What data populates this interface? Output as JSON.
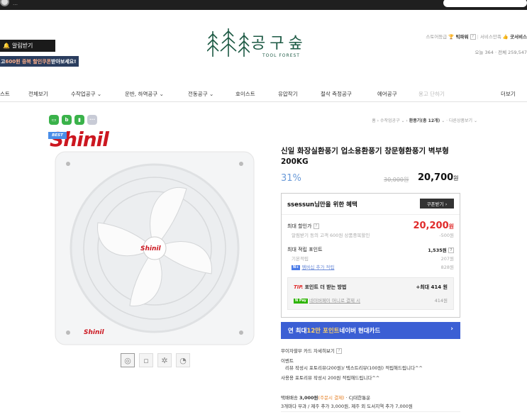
{
  "topbar": {
    "text": "…"
  },
  "header": {
    "alarm_label": "알림받기",
    "promo_prefix": "고 ",
    "promo_highlight": "600원 중복 할인쿠폰",
    "promo_suffix": " 받아보세요!",
    "logo_title": "공구숲",
    "logo_subtitle": "TOOL FOREST",
    "store_grade_label": "스토어등급",
    "store_grade_value": "빅파워",
    "service_label": "서비스만족",
    "service_value": "굿서비스",
    "visits": "오늘 364 · 전체 259,547"
  },
  "nav": {
    "items": [
      "스트",
      "전체보기",
      "수작업공구",
      "운반, 하역공구",
      "전동공구",
      "호이스트",
      "유압작기",
      "절삭 측정공구",
      "에어공구",
      "용고 단하기",
      "더보기"
    ]
  },
  "breadcrumb": {
    "home": "홈",
    "cat1": "수작업공구",
    "cat2": "환풍기(총 12개)",
    "more": "다른상품보기"
  },
  "colors": {
    "accent": "#3b5fd4",
    "brand": "#1d5a44",
    "discount": "#6a9ad8",
    "price_red": "#e02b2b"
  },
  "product": {
    "badge": "BEST",
    "brand_text": "Shinil",
    "title": "신일 화장실환풍기 업소용환풍기 창문형환풍기 벽부형 200KG",
    "discount_rate": "31%",
    "original_price": "30,000원",
    "price": "20,700",
    "price_unit": "원"
  },
  "benefit": {
    "heading": "ssessun님만을 위한 혜택",
    "coupon_button": "쿠폰받기 ›",
    "max_discount_label": "최대 할인가",
    "max_discount_value": "20,200",
    "max_discount_unit": "원",
    "alarm_coupon_desc": "알림받기 동의 고객 600원 상품중복할인",
    "alarm_coupon_value": "-500원",
    "max_point_label": "최대 적립 포인트",
    "max_point_value": "1,535원",
    "basic_point_label": "기본적립",
    "basic_point_value": "207원",
    "membership_label": "멤버십 추가 적립",
    "membership_value": "828원",
    "tip_label": "TIP.",
    "tip_text": "포인트 더 받는 방법",
    "tip_value": "+최대 414 원",
    "npay_label": "네이버페이 머니로 결제 시",
    "npay_value": "414원"
  },
  "card_banner": {
    "prefix": "연 최대 ",
    "highlight": "12만 포인트",
    "suffix": " 네이버 현대카드"
  },
  "info": {
    "installment": "무이자할부   카드 자세히보기",
    "event_label": "이벤트",
    "event_text": "리뷰 작성시 포토리뷰(200원)/ 텍스트리뷰(100원) 적립해드립니다^^",
    "usage_label": "사용용",
    "usage_text": "포토리뷰 작성시 200원 적립해드립니다^^",
    "shipping_label": "택배배송",
    "shipping_fee": "3,000원",
    "shipping_cod": "(주문시 결제)",
    "shipping_company": "· CJ대한통운",
    "shipping_extra": "3개마다 부과 / 제주 추가 3,000원, 제주 외 도서지역 추가 7,000원"
  }
}
